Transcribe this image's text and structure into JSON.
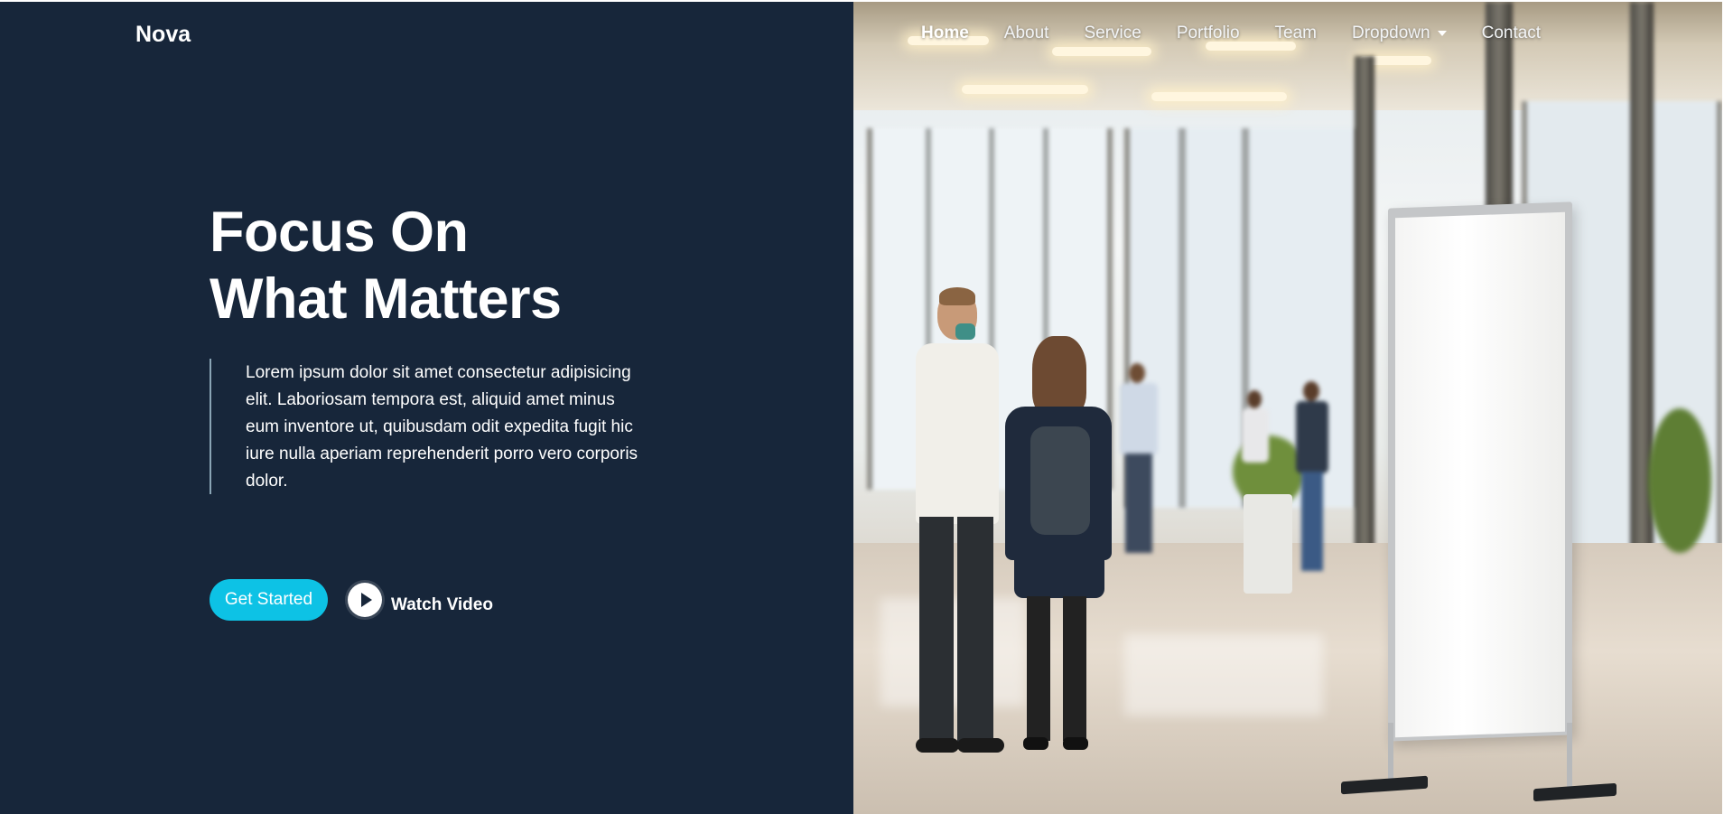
{
  "brand": "Nova",
  "nav": {
    "items": [
      {
        "label": "Home",
        "active": true
      },
      {
        "label": "About"
      },
      {
        "label": "Service"
      },
      {
        "label": "Portfolio"
      },
      {
        "label": "Team"
      },
      {
        "label": "Dropdown",
        "has_dropdown": true
      },
      {
        "label": "Contact"
      }
    ]
  },
  "hero": {
    "title_line1": "Focus On",
    "title_line2": "What Matters",
    "text": "Lorem ipsum dolor sit amet consectetur adipisicing elit. Laboriosam tempora est, aliquid amet minus eum inventore ut, quibusdam odit expedita fugit hic iure nulla aperiam reprehenderit porro vero corporis dolor.",
    "cta_label": "Get Started",
    "video_label": "Watch Video"
  },
  "colors": {
    "panel_bg": "#17263a",
    "accent": "#0dc2e5",
    "quote_bar": "#8aa5b5"
  },
  "icons": {
    "play": "play-icon",
    "dropdown": "caret-down-icon"
  }
}
